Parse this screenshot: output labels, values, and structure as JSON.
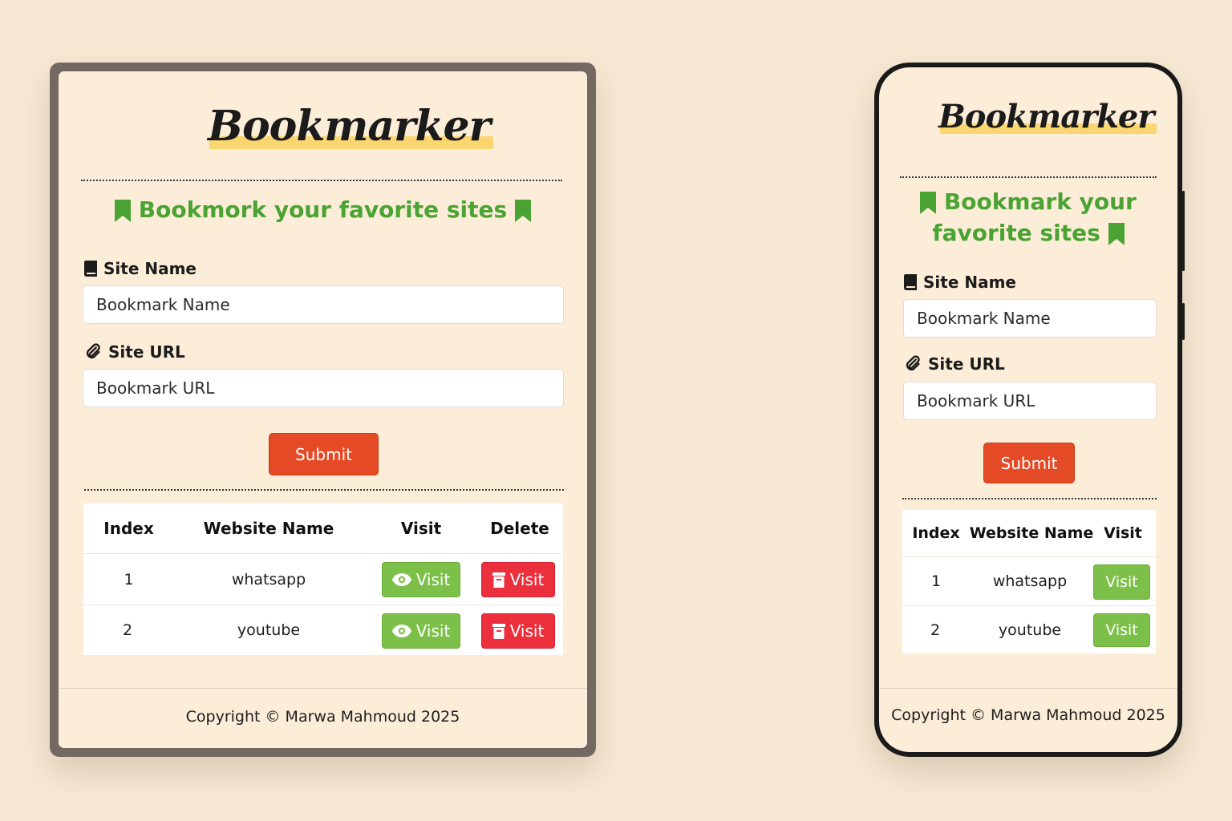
{
  "app": {
    "logo": "Bookmarker",
    "subtitle": "Bookmork your favorite sites",
    "subtitle_mobile_line1": "Bookmark your",
    "subtitle_mobile_line2": "favorite sites",
    "colors": {
      "accent_green": "#4aa332",
      "submit": "#e44a25",
      "visit": "#7cc04a",
      "delete": "#ec2f3d",
      "highlight": "#fbd56f"
    }
  },
  "form": {
    "site_name_label": "Site Name",
    "site_name_placeholder": "Bookmark Name",
    "site_url_label": "Site URL",
    "site_url_placeholder": "Bookmark URL",
    "submit_label": "Submit",
    "icons": {
      "site_name": "book-icon",
      "site_url": "paperclip-icon",
      "subtitle": "bookmark-icon"
    }
  },
  "table": {
    "headers": [
      "Index",
      "Website Name",
      "Visit",
      "Delete"
    ],
    "rows": [
      {
        "index": "1",
        "name": "whatsapp",
        "visit": "Visit",
        "delete": "Visit"
      },
      {
        "index": "2",
        "name": "youtube",
        "visit": "Visit",
        "delete": "Visit"
      }
    ],
    "icons": {
      "visit": "eye-icon",
      "delete": "trash-icon"
    }
  },
  "footer": {
    "text": "Copyright © Marwa Mahmoud 2025"
  }
}
